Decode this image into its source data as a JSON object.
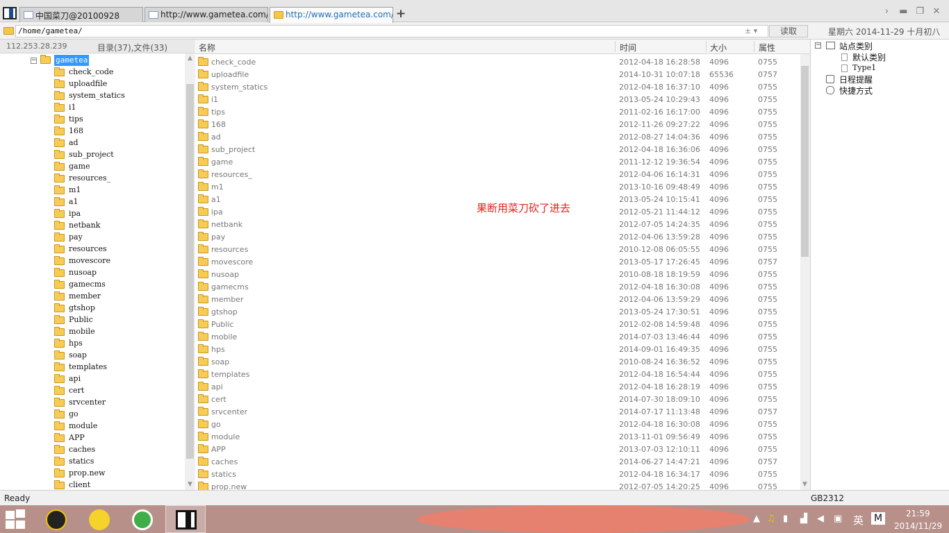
{
  "tabs": [
    {
      "label": "中国菜刀@20100928",
      "icon": "page-icon",
      "active": false
    },
    {
      "label": "http://www.gametea.com/ind...",
      "icon": "page-icon",
      "active": false
    },
    {
      "label": "http://www.gametea.com/ind...",
      "icon": "folder-icon",
      "active": true
    }
  ],
  "new_tab_label": "+",
  "window_controls": {
    "forward": "›",
    "minimize": "▬",
    "restore": "❐",
    "close": "✕"
  },
  "address_bar": {
    "path": "/home/gametea/",
    "controls": "± ▾",
    "read_button": "读取",
    "datetime": "星期六 2014-11-29 十月初八"
  },
  "left_panel": {
    "ip": "112.253.28.239",
    "dir_count": "目录(37),文件(33)",
    "root": {
      "toggle": "−",
      "label": "gametea"
    },
    "items": [
      "check_code",
      "uploadfile",
      "system_statics",
      "i1",
      "tips",
      "168",
      "ad",
      "sub_project",
      "game",
      "resources_",
      "m1",
      "a1",
      "ipa",
      "netbank",
      "pay",
      "resources",
      "movescore",
      "nusoap",
      "gamecms",
      "member",
      "gtshop",
      "Public",
      "mobile",
      "hps",
      "soap",
      "templates",
      "api",
      "cert",
      "srvcenter",
      "go",
      "module",
      "APP",
      "caches",
      "statics",
      "prop.new",
      "client"
    ]
  },
  "file_list": {
    "columns": {
      "name": "名称",
      "time": "时间",
      "size": "大小",
      "perm": "属性"
    },
    "rows": [
      {
        "name": "check_code",
        "time": "2012-04-18 16:28:58",
        "size": "4096",
        "perm": "0755"
      },
      {
        "name": "uploadfile",
        "time": "2014-10-31 10:07:18",
        "size": "65536",
        "perm": "0757"
      },
      {
        "name": "system_statics",
        "time": "2012-04-18 16:37:10",
        "size": "4096",
        "perm": "0755"
      },
      {
        "name": "i1",
        "time": "2013-05-24 10:29:43",
        "size": "4096",
        "perm": "0755"
      },
      {
        "name": "tips",
        "time": "2011-02-16 16:17:00",
        "size": "4096",
        "perm": "0755"
      },
      {
        "name": "168",
        "time": "2012-11-26 09:27:22",
        "size": "4096",
        "perm": "0755"
      },
      {
        "name": "ad",
        "time": "2012-08-27 14:04:36",
        "size": "4096",
        "perm": "0755"
      },
      {
        "name": "sub_project",
        "time": "2012-04-18 16:36:06",
        "size": "4096",
        "perm": "0755"
      },
      {
        "name": "game",
        "time": "2011-12-12 19:36:54",
        "size": "4096",
        "perm": "0755"
      },
      {
        "name": "resources_",
        "time": "2012-04-06 16:14:31",
        "size": "4096",
        "perm": "0755"
      },
      {
        "name": "m1",
        "time": "2013-10-16 09:48:49",
        "size": "4096",
        "perm": "0755"
      },
      {
        "name": "a1",
        "time": "2013-05-24 10:15:41",
        "size": "4096",
        "perm": "0755"
      },
      {
        "name": "ipa",
        "time": "2012-05-21 11:44:12",
        "size": "4096",
        "perm": "0755"
      },
      {
        "name": "netbank",
        "time": "2012-07-05 14:24:35",
        "size": "4096",
        "perm": "0755"
      },
      {
        "name": "pay",
        "time": "2012-04-06 13:59:28",
        "size": "4096",
        "perm": "0755"
      },
      {
        "name": "resources",
        "time": "2010-12-08 06:05:55",
        "size": "4096",
        "perm": "0755"
      },
      {
        "name": "movescore",
        "time": "2013-05-17 17:26:45",
        "size": "4096",
        "perm": "0757"
      },
      {
        "name": "nusoap",
        "time": "2010-08-18 18:19:59",
        "size": "4096",
        "perm": "0755"
      },
      {
        "name": "gamecms",
        "time": "2012-04-18 16:30:08",
        "size": "4096",
        "perm": "0755"
      },
      {
        "name": "member",
        "time": "2012-04-06 13:59:29",
        "size": "4096",
        "perm": "0755"
      },
      {
        "name": "gtshop",
        "time": "2013-05-24 17:30:51",
        "size": "4096",
        "perm": "0755"
      },
      {
        "name": "Public",
        "time": "2012-02-08 14:59:48",
        "size": "4096",
        "perm": "0755"
      },
      {
        "name": "mobile",
        "time": "2014-07-03 13:46:44",
        "size": "4096",
        "perm": "0755"
      },
      {
        "name": "hps",
        "time": "2014-09-01 16:49:35",
        "size": "4096",
        "perm": "0755"
      },
      {
        "name": "soap",
        "time": "2010-08-24 16:36:52",
        "size": "4096",
        "perm": "0755"
      },
      {
        "name": "templates",
        "time": "2012-04-18 16:54:44",
        "size": "4096",
        "perm": "0755"
      },
      {
        "name": "api",
        "time": "2012-04-18 16:28:19",
        "size": "4096",
        "perm": "0755"
      },
      {
        "name": "cert",
        "time": "2014-07-30 18:09:10",
        "size": "4096",
        "perm": "0755"
      },
      {
        "name": "srvcenter",
        "time": "2014-07-17 11:13:48",
        "size": "4096",
        "perm": "0757"
      },
      {
        "name": "go",
        "time": "2012-04-18 16:30:08",
        "size": "4096",
        "perm": "0755"
      },
      {
        "name": "module",
        "time": "2013-11-01 09:56:49",
        "size": "4096",
        "perm": "0755"
      },
      {
        "name": "APP",
        "time": "2013-07-03 12:10:11",
        "size": "4096",
        "perm": "0755"
      },
      {
        "name": "caches",
        "time": "2014-06-27 14:47:21",
        "size": "4096",
        "perm": "0757"
      },
      {
        "name": "statics",
        "time": "2012-04-18 16:34:17",
        "size": "4096",
        "perm": "0755"
      },
      {
        "name": "prop.new",
        "time": "2012-07-05 14:20:25",
        "size": "4096",
        "perm": "0755"
      }
    ],
    "annotation": "果断用菜刀砍了进去",
    "annotation_color": "#e2231a"
  },
  "right_panel": {
    "site_category": {
      "toggle": "⊟",
      "label": "站点类别"
    },
    "default_category": "默认类别",
    "type1": "Type1",
    "schedule": "日程提醒",
    "shortcuts": "快捷方式"
  },
  "status_bar": {
    "ready": "Ready",
    "encoding": "GB2312"
  },
  "taskbar": {
    "clock_time": "21:59",
    "clock_date": "2014/11/29",
    "ime_label": "英",
    "ime_mode": "M",
    "tray_up": "▲"
  },
  "colors": {
    "accent": "#3399ff",
    "taskbar": "#b7908a"
  }
}
